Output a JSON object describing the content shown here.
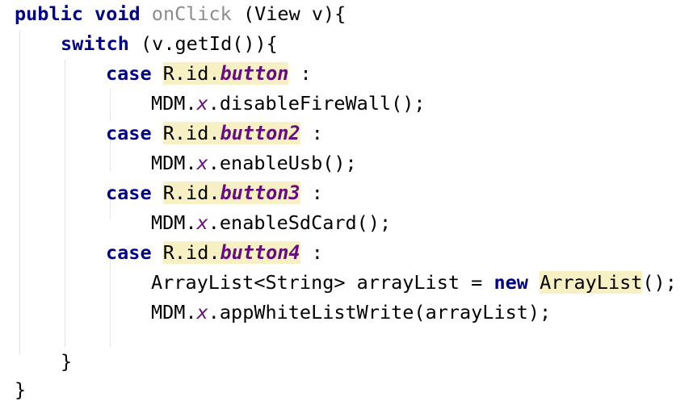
{
  "code": {
    "kw_public": "public",
    "kw_void": "void",
    "method_name": "onClick",
    "signature_rest": " (View v){",
    "kw_switch": "switch",
    "switch_rest": " (v.getId()){",
    "kw_case": "case",
    "r_prefix": "R",
    "id_prefix": ".id.",
    "button1": "button",
    "button2": "button2",
    "button3": "button3",
    "button4": "button4",
    "colon": " :",
    "mdm": "MDM.",
    "x": "x",
    "call_disable_firewall": ".disableFireWall();",
    "call_enable_usb": ".enableUsb();",
    "call_enable_sdcard": ".enableSdCard();",
    "arraylist_decl": "ArrayList<String> arrayList = ",
    "kw_new": "new",
    "arraylist_class": "ArrayList",
    "arraylist_paren": "();",
    "call_whitelist": ".appWhiteListWrite(arrayList);",
    "close_brace": "}"
  },
  "colors": {
    "keyword": "#000080",
    "method_gray": "#8c8c8c",
    "field_purple": "#660e7a",
    "highlight": "#f7f0c4",
    "indent_guide": "#e3e3e3"
  }
}
